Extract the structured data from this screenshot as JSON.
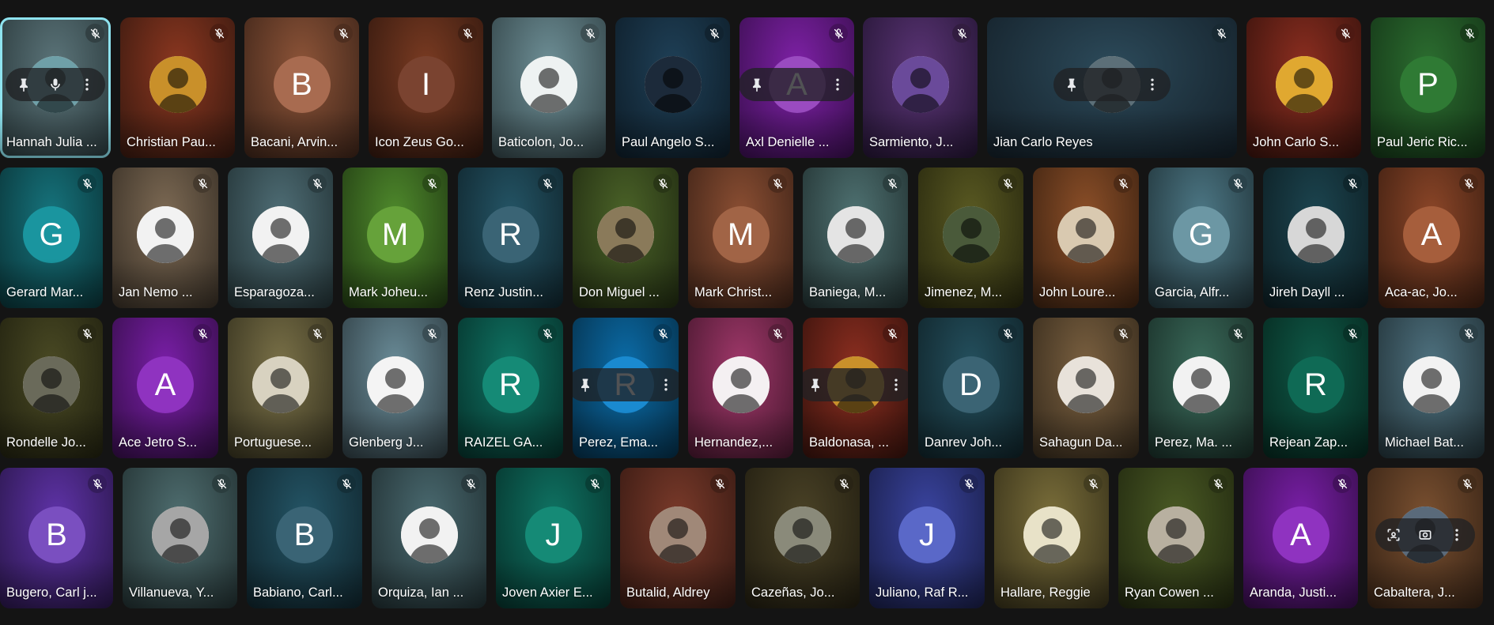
{
  "rows": [
    [
      {
        "name": "Hannah Julia ...",
        "kind": "photo",
        "bg": [
          "#5b7479",
          "#2b3a3d"
        ],
        "accent": "#6fa0a8",
        "active": true,
        "overlay": "mic"
      },
      {
        "name": "Christian Pau...",
        "kind": "photo",
        "bg": [
          "#8c3720",
          "#3b1a10"
        ],
        "accent": "#c9902a"
      },
      {
        "name": "Bacani, Arvin...",
        "kind": "letter",
        "letter": "B",
        "bg": [
          "#8d5438",
          "#40261a"
        ],
        "accent": "#a86b50"
      },
      {
        "name": "Icon Zeus Go...",
        "kind": "letter",
        "letter": "I",
        "bg": [
          "#7a3b22",
          "#35190f"
        ],
        "accent": "#7a4330"
      },
      {
        "name": "Baticolon, Jo...",
        "kind": "photo",
        "bg": [
          "#6e8f96",
          "#34464a"
        ],
        "accent": "#eef2f2"
      },
      {
        "name": "Paul Angelo S...",
        "kind": "photo",
        "bg": [
          "#1f4057",
          "#0e1e2a"
        ],
        "accent": "#1c2a3a"
      },
      {
        "name": "Axl Denielle ...",
        "kind": "letter",
        "letter": "A",
        "bg": [
          "#7e21a6",
          "#3c0f52"
        ],
        "accent": "#9a4bc0",
        "overlay": "pin"
      },
      {
        "name": "Sarmiento, J...",
        "kind": "photo",
        "bg": [
          "#5a3475",
          "#261636"
        ],
        "accent": "#6a4a9a"
      },
      {
        "name": "Jian Carlo Reyes",
        "kind": "photo",
        "bg": [
          "#2c4a5a",
          "#142029"
        ],
        "accent": "#5c6f78",
        "overlay": "pin"
      },
      {
        "name": "John Carlo S...",
        "kind": "photo",
        "bg": [
          "#8c2e20",
          "#3a130d"
        ],
        "accent": "#e0a830"
      },
      {
        "name": "Paul Jeric Ric...",
        "kind": "letter",
        "letter": "P",
        "bg": [
          "#2c6e30",
          "#153718"
        ],
        "accent": "#2f7a34"
      }
    ],
    [
      {
        "name": "Gerard Mar...",
        "kind": "letter",
        "letter": "G",
        "bg": [
          "#16747d",
          "#0a363a"
        ],
        "accent": "#1a959f"
      },
      {
        "name": "Jan Nemo ...",
        "kind": "photo",
        "bg": [
          "#7d6a54",
          "#3a3127"
        ],
        "accent": "#f2f2f2"
      },
      {
        "name": "Esparagoza...",
        "kind": "photo",
        "bg": [
          "#4f6e76",
          "#243437"
        ],
        "accent": "#f2f2f2"
      },
      {
        "name": "Mark Joheu...",
        "kind": "letter",
        "letter": "M",
        "bg": [
          "#4f8a2c",
          "#233e14"
        ],
        "accent": "#66a23a"
      },
      {
        "name": "Renz Justin...",
        "kind": "letter",
        "letter": "R",
        "bg": [
          "#245566",
          "#10262e"
        ],
        "accent": "#3a6475"
      },
      {
        "name": "Don Miguel ...",
        "kind": "photo",
        "bg": [
          "#4b6328",
          "#222d12"
        ],
        "accent": "#8a7a5a"
      },
      {
        "name": "Mark Christ...",
        "kind": "letter",
        "letter": "M",
        "bg": [
          "#8c4f33",
          "#402418"
        ],
        "accent": "#a16446"
      },
      {
        "name": "Baniega, M...",
        "kind": "photo",
        "bg": [
          "#4f7272",
          "#233333"
        ],
        "accent": "#e4e4e4"
      },
      {
        "name": "Jimenez, M...",
        "kind": "photo",
        "bg": [
          "#5a5a22",
          "#29290f"
        ],
        "accent": "#4a5a3a"
      },
      {
        "name": "John Loure...",
        "kind": "photo",
        "bg": [
          "#8c4f28",
          "#402412"
        ],
        "accent": "#d9c9b0"
      },
      {
        "name": "Garcia, Alfr...",
        "kind": "letter",
        "letter": "G",
        "bg": [
          "#4d7886",
          "#22363c"
        ],
        "accent": "#6c97a4"
      },
      {
        "name": "Jireh Dayll ...",
        "kind": "photo",
        "bg": [
          "#1c4550",
          "#0d1f24"
        ],
        "accent": "#d7d7d7"
      },
      {
        "name": "Aca-ac, Jo...",
        "kind": "letter",
        "letter": "A",
        "bg": [
          "#8c4628",
          "#402012"
        ],
        "accent": "#a65e3c"
      }
    ],
    [
      {
        "name": "Rondelle Jo...",
        "kind": "photo",
        "bg": [
          "#4a4a24",
          "#222210"
        ],
        "accent": "#6a6a5a"
      },
      {
        "name": "Ace Jetro S...",
        "kind": "letter",
        "letter": "A",
        "bg": [
          "#7a1fa8",
          "#380e4d"
        ],
        "accent": "#8f33c0"
      },
      {
        "name": "Portuguese...",
        "kind": "photo",
        "bg": [
          "#7a7148",
          "#383420"
        ],
        "accent": "#d8d2c0"
      },
      {
        "name": "Glenberg J...",
        "kind": "photo",
        "bg": [
          "#6a8c98",
          "#303f45"
        ],
        "accent": "#f4f4f4"
      },
      {
        "name": "RAIZEL GA...",
        "kind": "letter",
        "letter": "R",
        "bg": [
          "#0f7363",
          "#06342d"
        ],
        "accent": "#158a76"
      },
      {
        "name": "Perez, Ema...",
        "kind": "letter",
        "letter": "R",
        "bg": [
          "#0b6ca8",
          "#05314c"
        ],
        "accent": "#1a8ad0",
        "overlay": "pin"
      },
      {
        "name": "Hernandez,...",
        "kind": "photo",
        "bg": [
          "#a0386a",
          "#4a1830"
        ],
        "accent": "#f4f0f2"
      },
      {
        "name": "Baldonasa, ...",
        "kind": "photo",
        "bg": [
          "#8c2e20",
          "#3a130d"
        ],
        "accent": "#c9902a",
        "overlay": "pin"
      },
      {
        "name": "Danrev Joh...",
        "kind": "letter",
        "letter": "D",
        "bg": [
          "#24505e",
          "#10242a"
        ],
        "accent": "#3b6474"
      },
      {
        "name": "Sahagun Da...",
        "kind": "photo",
        "bg": [
          "#7a6040",
          "#382c1d"
        ],
        "accent": "#e8e2da"
      },
      {
        "name": "Perez, Ma. ...",
        "kind": "photo",
        "bg": [
          "#3a6a5a",
          "#1a3029"
        ],
        "accent": "#f2f2f2"
      },
      {
        "name": "Rejean Zap...",
        "kind": "letter",
        "letter": "R",
        "bg": [
          "#0f5a48",
          "#062920"
        ],
        "accent": "#0f6a55"
      },
      {
        "name": "Michael Bat...",
        "kind": "photo",
        "bg": [
          "#4f7280",
          "#23343a"
        ],
        "accent": "#f2f2f2"
      }
    ],
    [
      {
        "name": "Bugero, Carl j...",
        "kind": "letter",
        "letter": "B",
        "bg": [
          "#5f33a8",
          "#2b174d"
        ],
        "accent": "#7a4fc0"
      },
      {
        "name": "Villanueva, Y...",
        "kind": "photo",
        "bg": [
          "#4f6e70",
          "#233233"
        ],
        "accent": "#a6a6a6"
      },
      {
        "name": "Babiano, Carl...",
        "kind": "letter",
        "letter": "B",
        "bg": [
          "#245566",
          "#10262e"
        ],
        "accent": "#3a6475"
      },
      {
        "name": "Orquiza, Ian ...",
        "kind": "photo",
        "bg": [
          "#4a6a70",
          "#213033"
        ],
        "accent": "#f2f2f2"
      },
      {
        "name": "Joven Axier E...",
        "kind": "letter",
        "letter": "J",
        "bg": [
          "#0f7363",
          "#06342d"
        ],
        "accent": "#158a76"
      },
      {
        "name": "Butalid, Aldrey",
        "kind": "photo",
        "bg": [
          "#7a3a2a",
          "#381a13"
        ],
        "accent": "#a08878"
      },
      {
        "name": "Cazeñas, Jo...",
        "kind": "photo",
        "bg": [
          "#4a4226",
          "#221e11"
        ],
        "accent": "#8a8a7a"
      },
      {
        "name": "Juliano, Raf R...",
        "kind": "letter",
        "letter": "J",
        "bg": [
          "#3a44a0",
          "#1a1f4a"
        ],
        "accent": "#5a68c8"
      },
      {
        "name": "Hallare, Reggie",
        "kind": "photo",
        "bg": [
          "#7a6e3a",
          "#38321a"
        ],
        "accent": "#e8e2c8"
      },
      {
        "name": "Ryan Cowen ...",
        "kind": "photo",
        "bg": [
          "#4a5a24",
          "#222910"
        ],
        "accent": "#b8b0a0"
      },
      {
        "name": "Aranda, Justi...",
        "kind": "letter",
        "letter": "A",
        "bg": [
          "#7a1fa8",
          "#380e4d"
        ],
        "accent": "#8f33c0"
      },
      {
        "name": "Cabaltera, J...",
        "kind": "photo",
        "bg": [
          "#7a5030",
          "#382416"
        ],
        "accent": "#5a6a7a",
        "overlay": "effects"
      }
    ]
  ],
  "colors": {
    "mute_icon": "#ffffff",
    "overlay_bg": "#202124",
    "active_border": "#8ee3ef",
    "page_bg": "#141414"
  },
  "icons": {
    "mute": "mic-off-icon",
    "pin": "pin-icon",
    "more": "more-vert-icon",
    "mic": "mic-icon",
    "effects": "visual-effects-icon",
    "frame": "frame-icon"
  }
}
